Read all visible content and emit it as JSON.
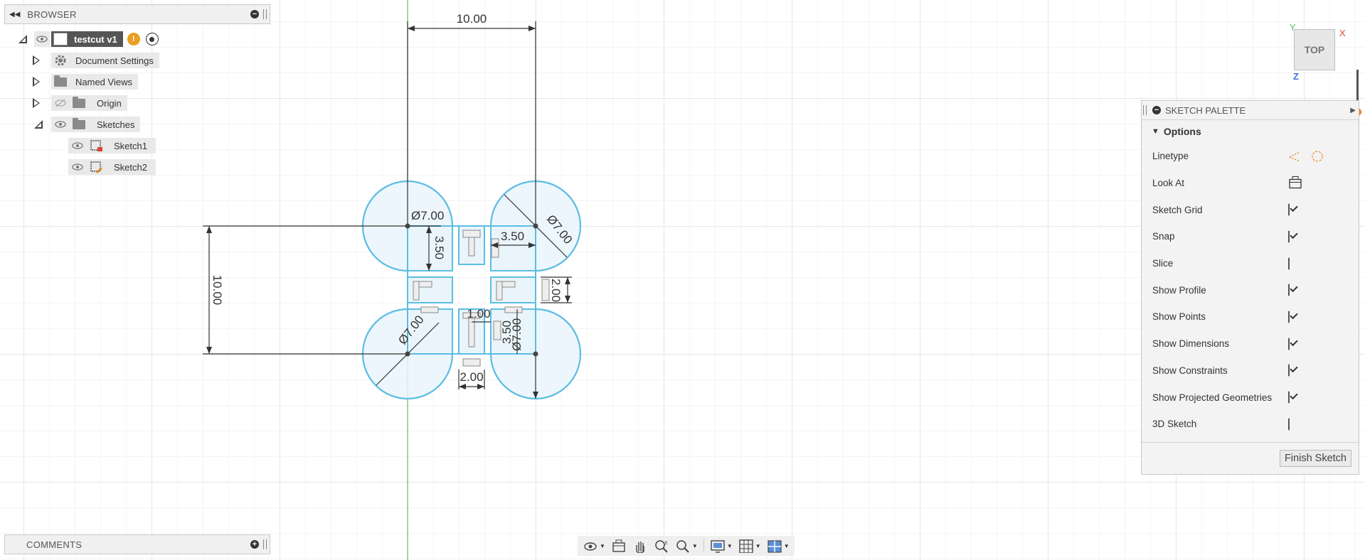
{
  "browser": {
    "title": "BROWSER",
    "root_label": "testcut v1",
    "items": [
      {
        "label": "Document Settings"
      },
      {
        "label": "Named Views"
      },
      {
        "label": "Origin"
      },
      {
        "label": "Sketches"
      },
      {
        "label": "Sketch1"
      },
      {
        "label": "Sketch2"
      }
    ]
  },
  "comments": {
    "title": "COMMENTS"
  },
  "viewcube": {
    "face": "TOP",
    "x_label": "X",
    "y_label": "Y",
    "z_label": "Z"
  },
  "sketch_dims": {
    "top_width": "10.00",
    "left_height": "10.00",
    "dia_tl": "Ø7.00",
    "dia_tr": "Ø7.00",
    "dia_bl": "Ø7.00",
    "dia_br": "Ø7.00",
    "d_350_a": "3.50",
    "d_350_b": "3.50",
    "d_350_c": "3.50",
    "d_200_a": "2.00",
    "d_200_b": "2.00",
    "d_100": "1.00"
  },
  "palette": {
    "title": "SKETCH PALETTE",
    "section": "Options",
    "rows": [
      {
        "label": "Linetype",
        "control": "linetype"
      },
      {
        "label": "Look At",
        "control": "lookat"
      },
      {
        "label": "Sketch Grid",
        "checked": true
      },
      {
        "label": "Snap",
        "checked": true
      },
      {
        "label": "Slice",
        "checked": false
      },
      {
        "label": "Show Profile",
        "checked": true
      },
      {
        "label": "Show Points",
        "checked": true
      },
      {
        "label": "Show Dimensions",
        "checked": true
      },
      {
        "label": "Show Constraints",
        "checked": true
      },
      {
        "label": "Show Projected Geometries",
        "checked": true
      },
      {
        "label": "3D Sketch",
        "checked": false
      }
    ],
    "finish_label": "Finish Sketch"
  },
  "toolbar": {
    "items": [
      "orbit-icon",
      "look-at-icon",
      "pan-icon",
      "zoom-window-icon",
      "zoom-icon",
      "display-settings-icon",
      "grid-icon",
      "viewports-icon"
    ]
  },
  "colors": {
    "sketch_curve": "#5bbde3",
    "fill": "#e8f4fb",
    "dim_line": "#333333",
    "axis_green": "#6cc46c",
    "accent_orange": "#e8831e"
  }
}
